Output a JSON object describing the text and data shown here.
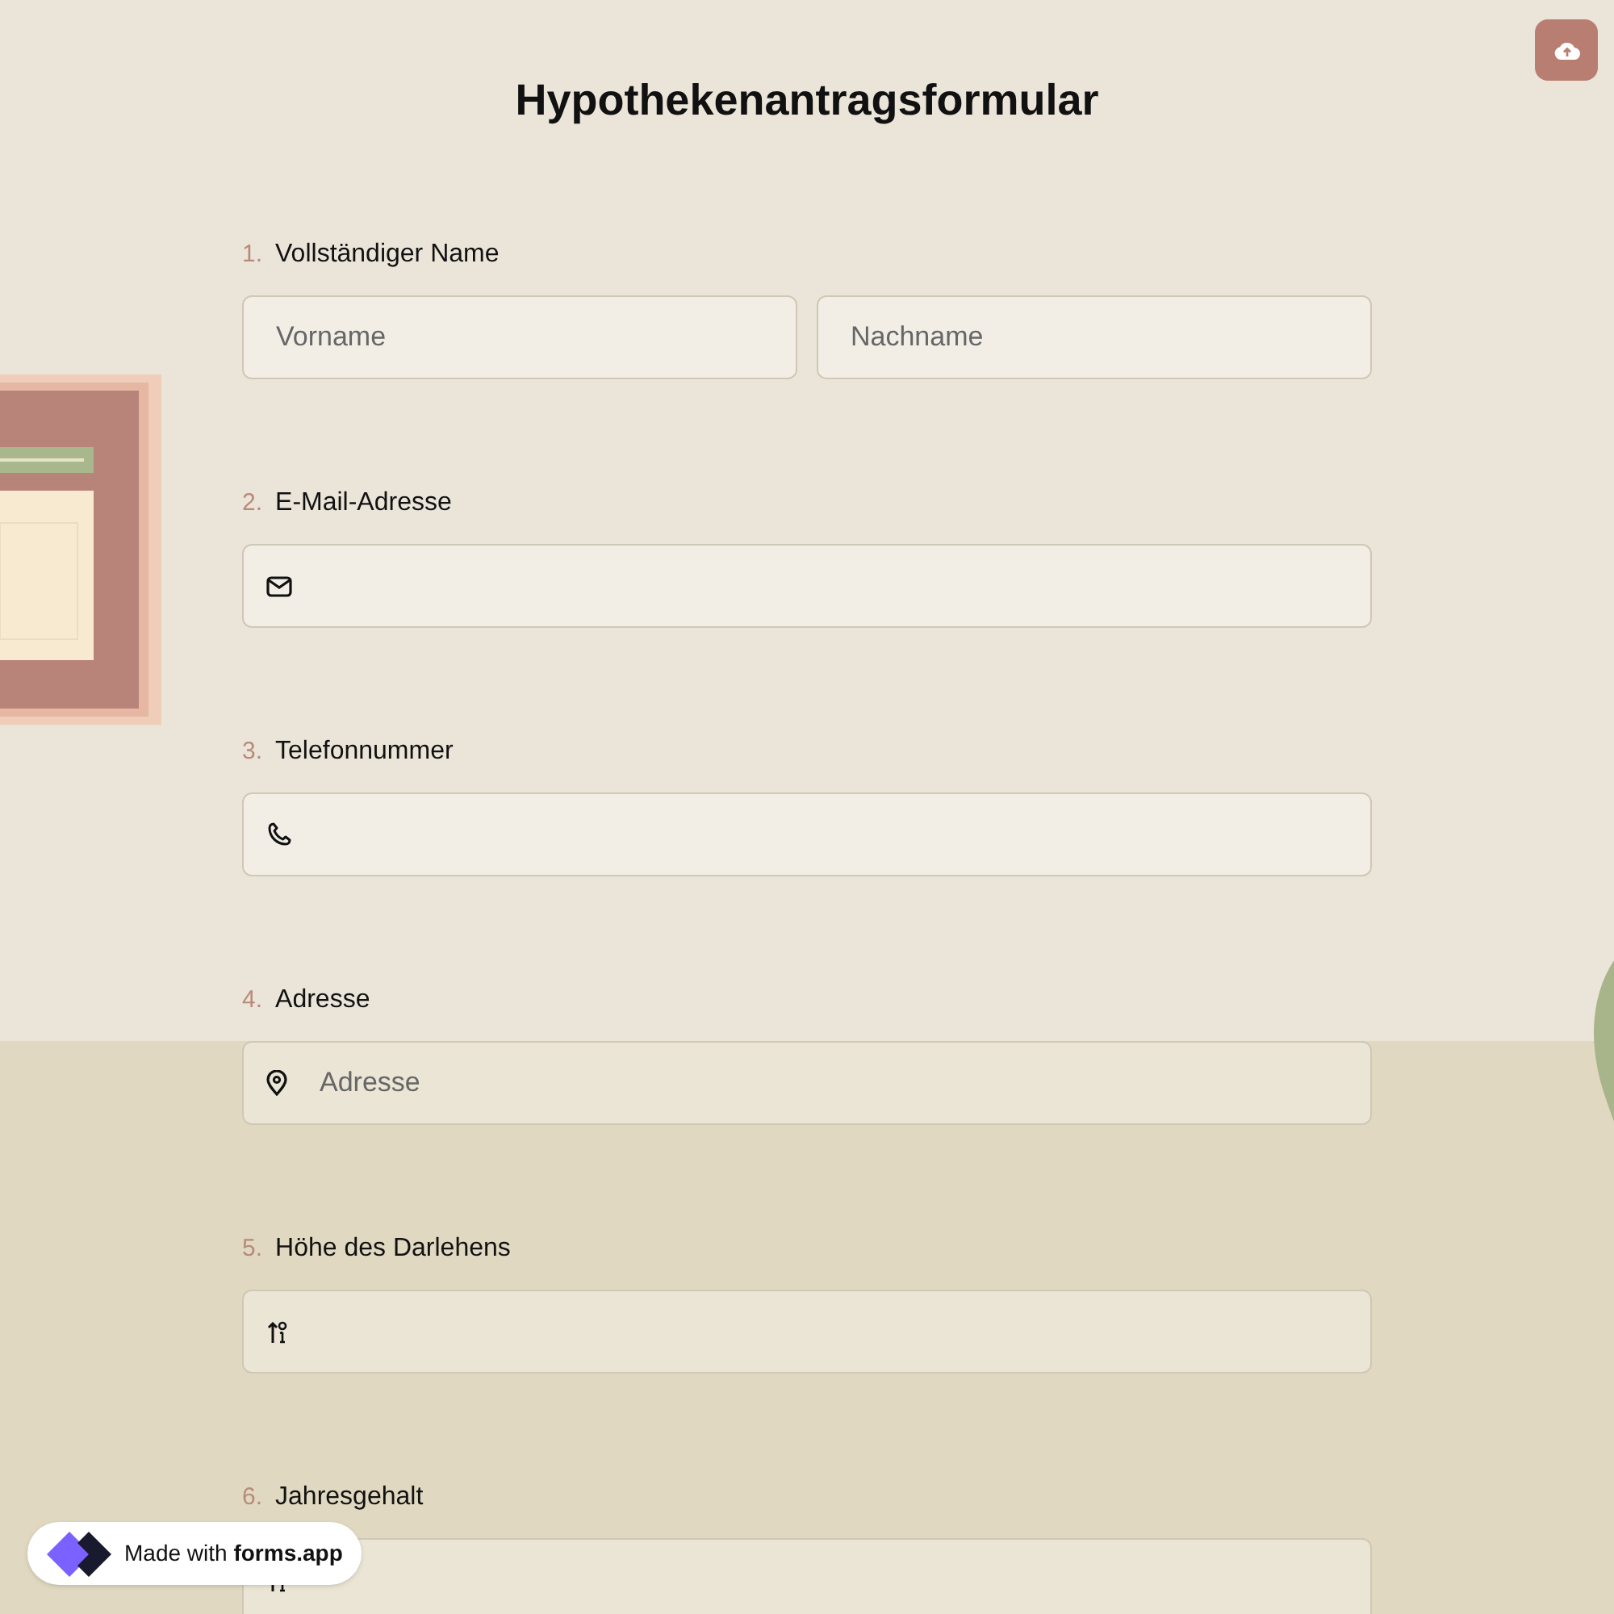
{
  "title": "Hypothekenantragsformular",
  "questions": [
    {
      "number": "1.",
      "label": "Vollständiger Name",
      "kind": "name",
      "fields": [
        {
          "placeholder": "Vorname"
        },
        {
          "placeholder": "Nachname"
        }
      ]
    },
    {
      "number": "2.",
      "label": "E-Mail-Adresse",
      "kind": "email"
    },
    {
      "number": "3.",
      "label": "Telefonnummer",
      "kind": "phone"
    },
    {
      "number": "4.",
      "label": "Adresse",
      "kind": "address",
      "fields": [
        {
          "placeholder": "Adresse"
        }
      ]
    },
    {
      "number": "5.",
      "label": "Höhe des Darlehens",
      "kind": "number"
    },
    {
      "number": "6.",
      "label": "Jahresgehalt",
      "kind": "number"
    }
  ],
  "badge": {
    "text": "Made with **forms.app**"
  }
}
